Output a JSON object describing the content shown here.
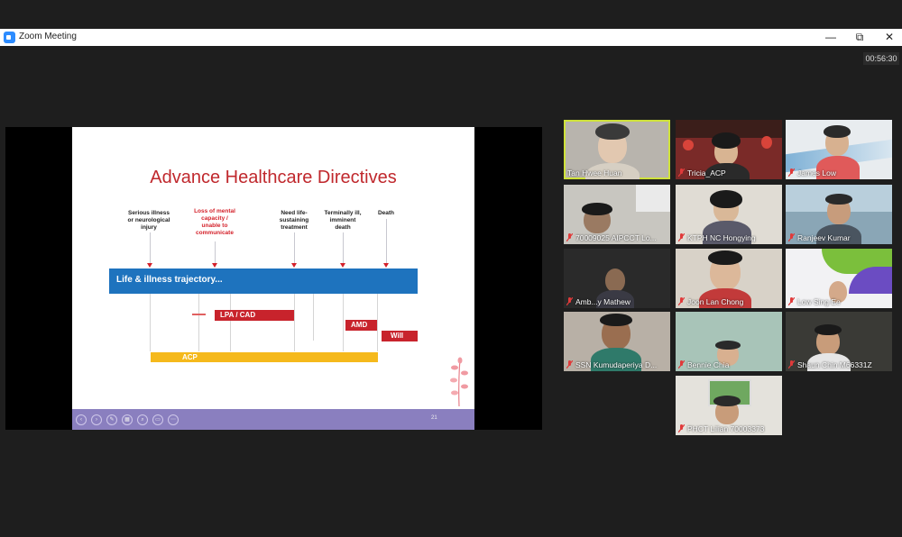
{
  "window": {
    "title": "Zoom Meeting",
    "timer": "00:56:30",
    "controls": [
      "—",
      "⧉",
      "✕"
    ]
  },
  "slide": {
    "title": "Advance Healthcare Directives",
    "stages": [
      {
        "label": "Serious illness or neurological injury",
        "lines": [
          "Serious illness",
          "or neurological",
          "injury"
        ],
        "highlight": false
      },
      {
        "label": "Loss of mental capacity / unable to communicate",
        "lines": [
          "Loss of mental",
          "capacity /",
          "unable to",
          "communicate"
        ],
        "highlight": true
      },
      {
        "label": "Need life-sustaining treatment",
        "lines": [
          "Need life-",
          "sustaining",
          "treatment"
        ],
        "highlight": false
      },
      {
        "label": "Terminally ill, imminent death",
        "lines": [
          "Terminally ill,",
          "imminent",
          "death"
        ],
        "highlight": false
      },
      {
        "label": "Death",
        "lines": [
          "Death"
        ],
        "highlight": false
      }
    ],
    "trajectory_label": "Life & illness trajectory...",
    "bars": {
      "lpa": "LPA / CAD",
      "amd": "AMD",
      "will": "Will",
      "acp": "ACP"
    },
    "page_number": "21",
    "colors": {
      "title": "#c0282d",
      "trajectory": "#1e73be",
      "red_bar": "#c8232c",
      "acp_bar": "#f5b91c",
      "toolbar": "#8a7fbf"
    }
  },
  "participants": [
    {
      "name": "Tan Hwee Huan",
      "muted": false,
      "active_speaker": true
    },
    {
      "name": "Tricia_ACP",
      "muted": true,
      "active_speaker": false
    },
    {
      "name": "James Low",
      "muted": true,
      "active_speaker": false
    },
    {
      "name": "70009025 AIPCCT Lo...",
      "muted": true,
      "active_speaker": false
    },
    {
      "name": "KTPH NC Hongying",
      "muted": true,
      "active_speaker": false
    },
    {
      "name": "Ranjeev Kumar",
      "muted": true,
      "active_speaker": false
    },
    {
      "name": "Amb...y Mathew",
      "muted": true,
      "active_speaker": false
    },
    {
      "name": "Joon Lan Chong",
      "muted": true,
      "active_speaker": false
    },
    {
      "name": "Low Sing Ee",
      "muted": true,
      "active_speaker": false
    },
    {
      "name": "SSN Kumudaperiya D...",
      "muted": true,
      "active_speaker": false
    },
    {
      "name": "Bennie Chia",
      "muted": true,
      "active_speaker": false
    },
    {
      "name": "Shaun Chin M66331Z",
      "muted": true,
      "active_speaker": false
    },
    {
      "name": "PHCT Lilian 70003373",
      "muted": true,
      "active_speaker": false
    }
  ]
}
